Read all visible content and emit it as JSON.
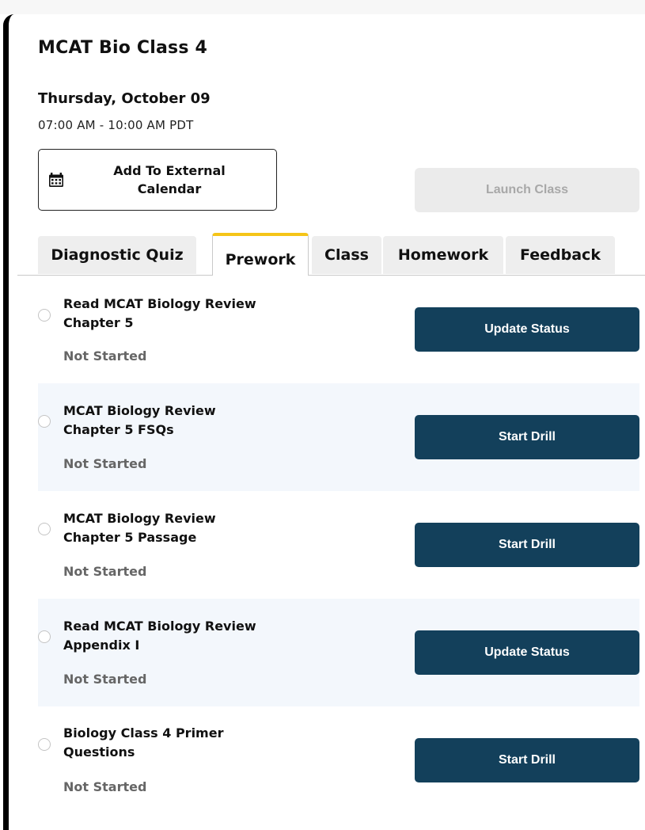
{
  "class": {
    "title": "MCAT Bio Class 4",
    "date": "Thursday, October 09",
    "time": "07:00 AM - 10:00 AM PDT"
  },
  "actions": {
    "calendar_label": "Add To External Calendar",
    "calendar_icon": "calendar-icon",
    "launch_label": "Launch Class"
  },
  "tabs": [
    {
      "label": "Diagnostic Quiz",
      "active": false
    },
    {
      "label": "Prework",
      "active": true
    },
    {
      "label": "Class",
      "active": false
    },
    {
      "label": "Homework",
      "active": false
    },
    {
      "label": "Feedback",
      "active": false
    }
  ],
  "tasks": [
    {
      "name": "Read MCAT Biology Review Chapter 5",
      "status": "Not Started",
      "button": "Update Status"
    },
    {
      "name": "MCAT Biology Review Chapter 5 FSQs",
      "status": "Not Started",
      "button": "Start Drill"
    },
    {
      "name": "MCAT Biology Review Chapter 5 Passage",
      "status": "Not Started",
      "button": "Start Drill"
    },
    {
      "name": "Read MCAT Biology Review Appendix I",
      "status": "Not Started",
      "button": "Update Status"
    },
    {
      "name": "Biology Class 4 Primer Questions",
      "status": "Not Started",
      "button": "Start Drill"
    }
  ],
  "colors": {
    "primary_button": "#13405b",
    "active_tab_accent": "#f5c518",
    "disabled_button": "#ebebeb",
    "shaded_row": "#f3f7fc"
  }
}
